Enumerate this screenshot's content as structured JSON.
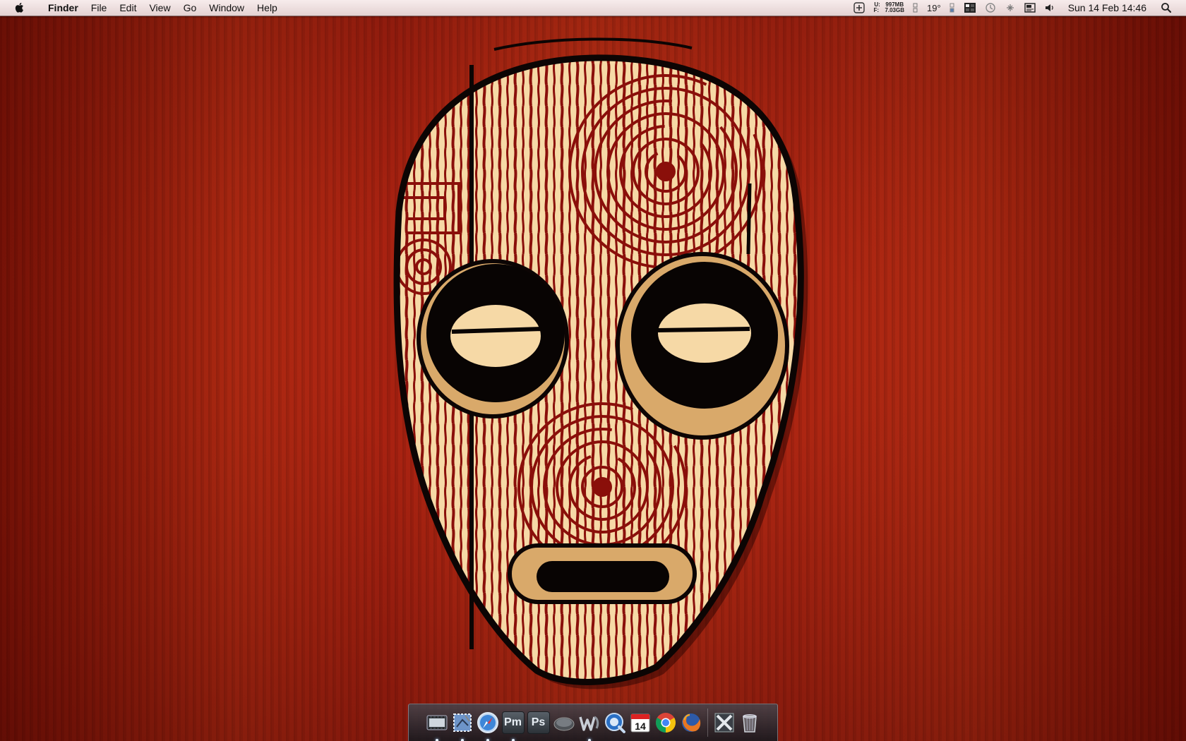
{
  "menubar": {
    "app_name": "Finder",
    "menus": [
      "File",
      "Edit",
      "View",
      "Go",
      "Window",
      "Help"
    ],
    "memory": {
      "used_label": "U:",
      "used_value": "997MB",
      "free_label": "F:",
      "free_value": "7.03GB"
    },
    "temperature": "19°",
    "clock": "Sun 14 Feb  14:46"
  },
  "dock": {
    "items": [
      {
        "name": "film-strip-app",
        "running": true
      },
      {
        "name": "mail-app",
        "running": true
      },
      {
        "name": "safari-app",
        "running": true
      },
      {
        "name": "pm-app",
        "label": "Pm",
        "running": true
      },
      {
        "name": "photoshop-app",
        "label": "Ps",
        "running": false
      },
      {
        "name": "pill-app",
        "running": false
      },
      {
        "name": "textwrangler-app",
        "running": true
      },
      {
        "name": "quicktime-app",
        "running": false
      },
      {
        "name": "ical-app",
        "label": "14",
        "running": false
      },
      {
        "name": "chrome-app",
        "running": false
      },
      {
        "name": "firefox-app",
        "running": false
      },
      {
        "name": "x11-app",
        "running": false
      },
      {
        "name": "trash",
        "running": false
      }
    ]
  },
  "colors": {
    "wallpaper_red": "#a82311",
    "mask_cream": "#f6d9a6",
    "mask_stripe": "#8a0f0a",
    "eye_ring": "#d9a96a"
  }
}
